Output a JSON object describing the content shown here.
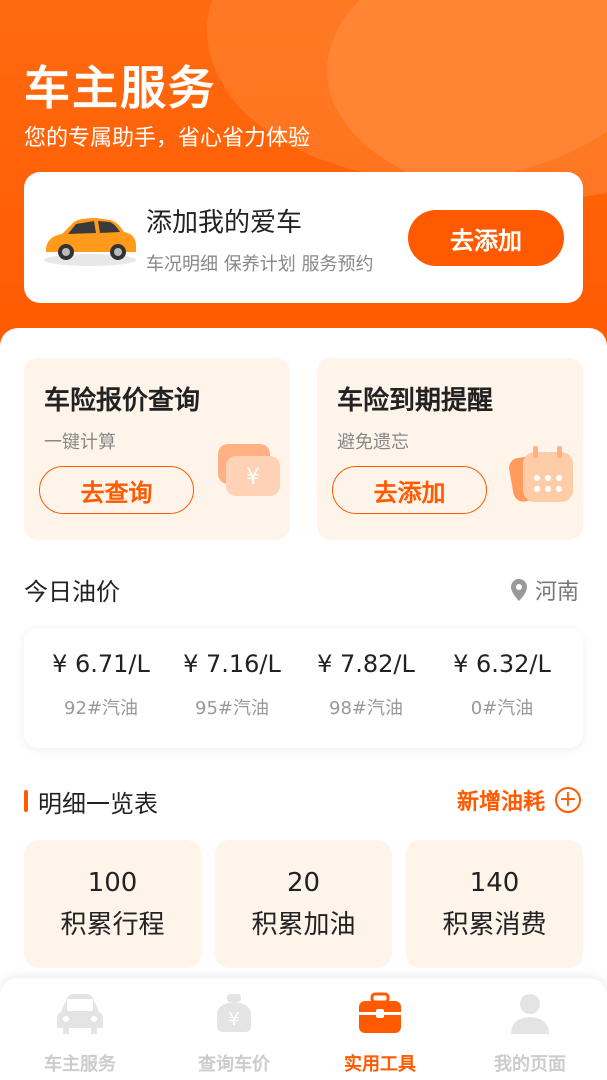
{
  "header": {
    "title": "车主服务",
    "subtitle": "您的专属助手，省心省力体验"
  },
  "car_card": {
    "title": "添加我的爱车",
    "subtitle": "车况明细 保养计划 服务预约",
    "button": "去添加",
    "icon": "car-icon"
  },
  "insurance": [
    {
      "title": "车险报价查询",
      "subtitle": "一键计算",
      "button": "去查询",
      "icon": "yuan-card-icon"
    },
    {
      "title": "车险到期提醒",
      "subtitle": "避免遗忘",
      "button": "去添加",
      "icon": "calendar-icon"
    }
  ],
  "oil": {
    "title": "今日油价",
    "location": "河南",
    "items": [
      {
        "price": "¥ 6.71/L",
        "type": "92#汽油"
      },
      {
        "price": "¥ 7.16/L",
        "type": "95#汽油"
      },
      {
        "price": "¥ 7.82/L",
        "type": "98#汽油"
      },
      {
        "price": "¥ 6.32/L",
        "type": "0#汽油"
      }
    ]
  },
  "detail": {
    "title": "明细一览表",
    "add_label": "新增油耗",
    "stats": [
      {
        "value": "100",
        "label": "积累行程"
      },
      {
        "value": "20",
        "label": "积累加油"
      },
      {
        "value": "140",
        "label": "积累消费"
      }
    ]
  },
  "tabs": [
    {
      "label": "车主服务",
      "icon": "car-front-icon",
      "active": false
    },
    {
      "label": "查询车价",
      "icon": "price-tag-icon",
      "active": false
    },
    {
      "label": "实用工具",
      "icon": "toolbox-icon",
      "active": true
    },
    {
      "label": "我的页面",
      "icon": "user-icon",
      "active": false
    }
  ],
  "colors": {
    "accent": "#ff5a00",
    "card_bg": "#fff4ea"
  }
}
